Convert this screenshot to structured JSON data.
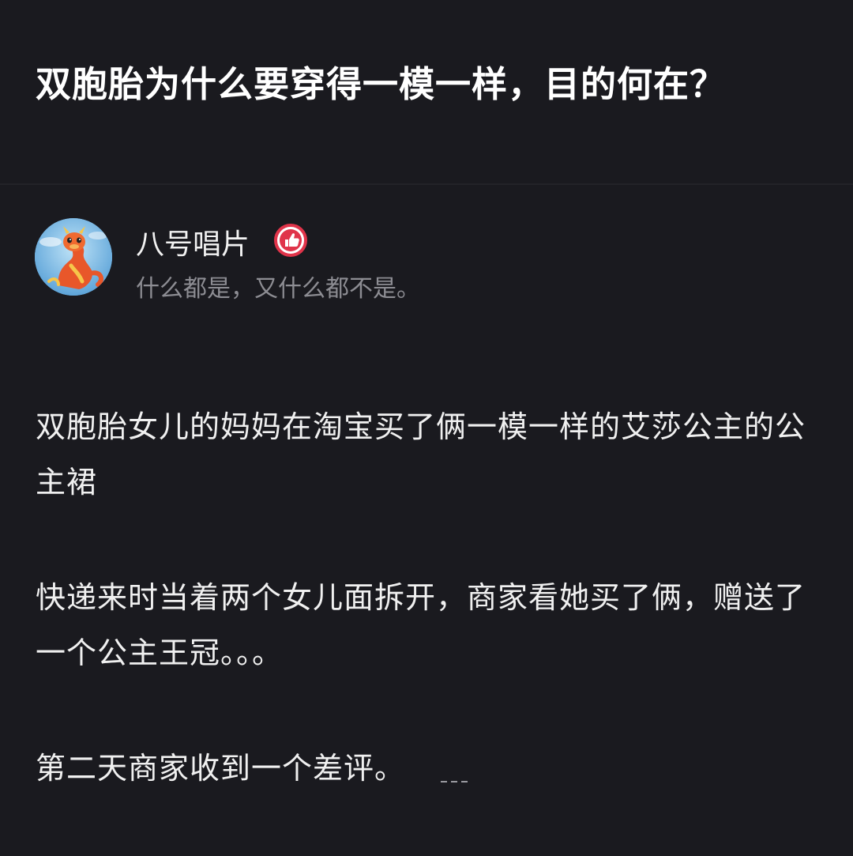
{
  "question": {
    "title": "双胞胎为什么要穿得一模一样，目的何在？"
  },
  "author": {
    "name": "八号唱片",
    "bio": "什么都是，又什么都不是。",
    "avatar_icon": "dragon-avatar-icon",
    "badge_icon": "thumbs-up-badge-icon",
    "badge_color": "#e0344a"
  },
  "answer": {
    "paragraphs": [
      "双胞胎女儿的妈妈在淘宝买了俩一模一样的艾莎公主的公主裙",
      "快递来时当着两个女儿面拆开，商家看她买了俩，赠送了一个公主王冠。。。",
      "第二天商家收到一个差评。"
    ]
  },
  "colors": {
    "background": "#1a1a1f",
    "text_primary": "#f0f0f0",
    "text_secondary": "#8d8d93"
  }
}
